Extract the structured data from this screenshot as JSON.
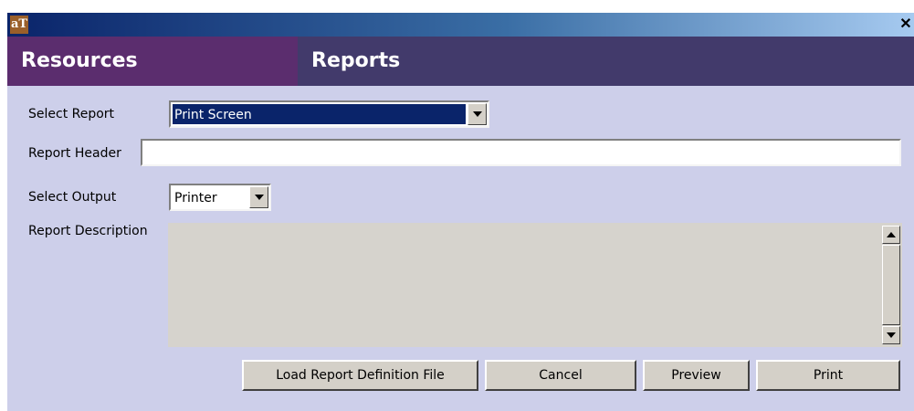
{
  "window": {
    "app_icon": "aT",
    "close_label": "✕"
  },
  "header": {
    "left_title": "Resources",
    "right_title": "Reports"
  },
  "form": {
    "select_report_label": "Select Report",
    "select_report_value": "Print Screen",
    "report_header_label": "Report Header",
    "report_header_value": "",
    "select_output_label": "Select Output",
    "select_output_value": "Printer",
    "report_description_label": "Report Description",
    "report_description_value": ""
  },
  "buttons": {
    "load": "Load Report Definition File",
    "cancel": "Cancel",
    "preview": "Preview",
    "print": "Print"
  },
  "colors": {
    "window_bg": "#cdcfea",
    "header_left_bg": "#5b2d6e",
    "header_right_bg": "#423a6b",
    "selection_bg": "#0a246a",
    "description_bg": "#d6d3cd"
  },
  "icons": {
    "app": "app-logo-icon",
    "close": "close-icon",
    "dropdown": "chevron-down-icon",
    "scroll_up": "scroll-up-arrow-icon",
    "scroll_down": "scroll-down-arrow-icon"
  }
}
